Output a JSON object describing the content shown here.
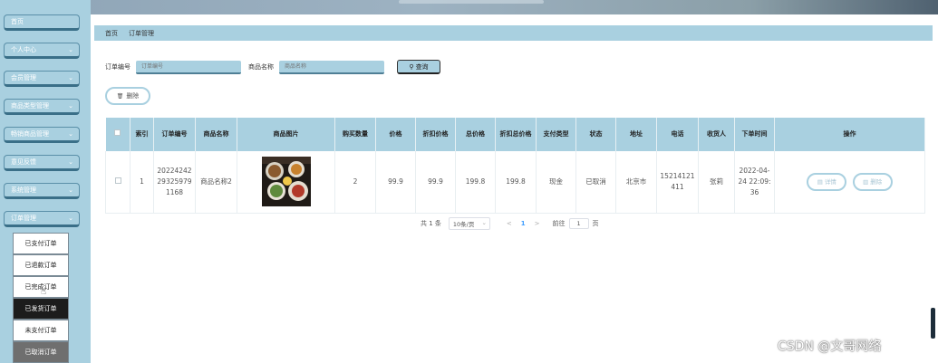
{
  "sidebar": {
    "items": [
      {
        "label": "首页",
        "chev": ""
      },
      {
        "label": "个人中心",
        "chev": "⌄"
      },
      {
        "label": "会员管理",
        "chev": "⌄"
      },
      {
        "label": "商品类型管理",
        "chev": "⌄"
      },
      {
        "label": "畅销商品管理",
        "chev": "⌄"
      },
      {
        "label": "意见反馈",
        "chev": "⌄"
      },
      {
        "label": "系统管理",
        "chev": "⌄"
      },
      {
        "label": "订单管理",
        "chev": "⌄"
      }
    ],
    "submenu": [
      {
        "label": "已支付订单"
      },
      {
        "label": "已退款订单"
      },
      {
        "label": "已完成订单"
      },
      {
        "label": "已发货订单"
      },
      {
        "label": "未支付订单"
      },
      {
        "label": "已取消订单"
      }
    ]
  },
  "breadcrumb": {
    "home": "首页",
    "current": "订单管理"
  },
  "search": {
    "order_no_label": "订单编号",
    "order_no_placeholder": "订单编号",
    "product_label": "商品名称",
    "product_placeholder": "商品名称",
    "search_button": "查询",
    "search_icon": "⚲"
  },
  "toolbar": {
    "delete_label": "删除",
    "delete_icon": "🗑"
  },
  "table": {
    "headers": [
      "索引",
      "订单编号",
      "商品名称",
      "商品图片",
      "购买数量",
      "价格",
      "折扣价格",
      "总价格",
      "折扣总价格",
      "支付类型",
      "状态",
      "地址",
      "电话",
      "收货人",
      "下单时间",
      "操作"
    ],
    "rows": [
      {
        "index": "1",
        "order_no": "2022424229325979 1168",
        "product_name": "商品名称2",
        "quantity": "2",
        "price": "99.9",
        "discount_price": "99.9",
        "total": "199.8",
        "discount_total": "199.8",
        "pay_type": "现金",
        "status": "已取消",
        "address": "北京市",
        "phone": "15214121411",
        "receiver": "张莉",
        "order_time": "2022-04-24 22:09:36",
        "detail_button": "详情",
        "delete_button": "删除"
      }
    ]
  },
  "pager": {
    "total": "共 1 条",
    "page_size": "10条/页",
    "prev": "<",
    "current": "1",
    "next": ">",
    "goto_label": "前往",
    "goto_value": "1",
    "page_suffix": "页"
  },
  "watermark": "CSDN @文哥网络",
  "colors": {
    "accent": "#a9d0e0",
    "border_dark": "#3a6f88",
    "pager_current": "#409eff"
  }
}
